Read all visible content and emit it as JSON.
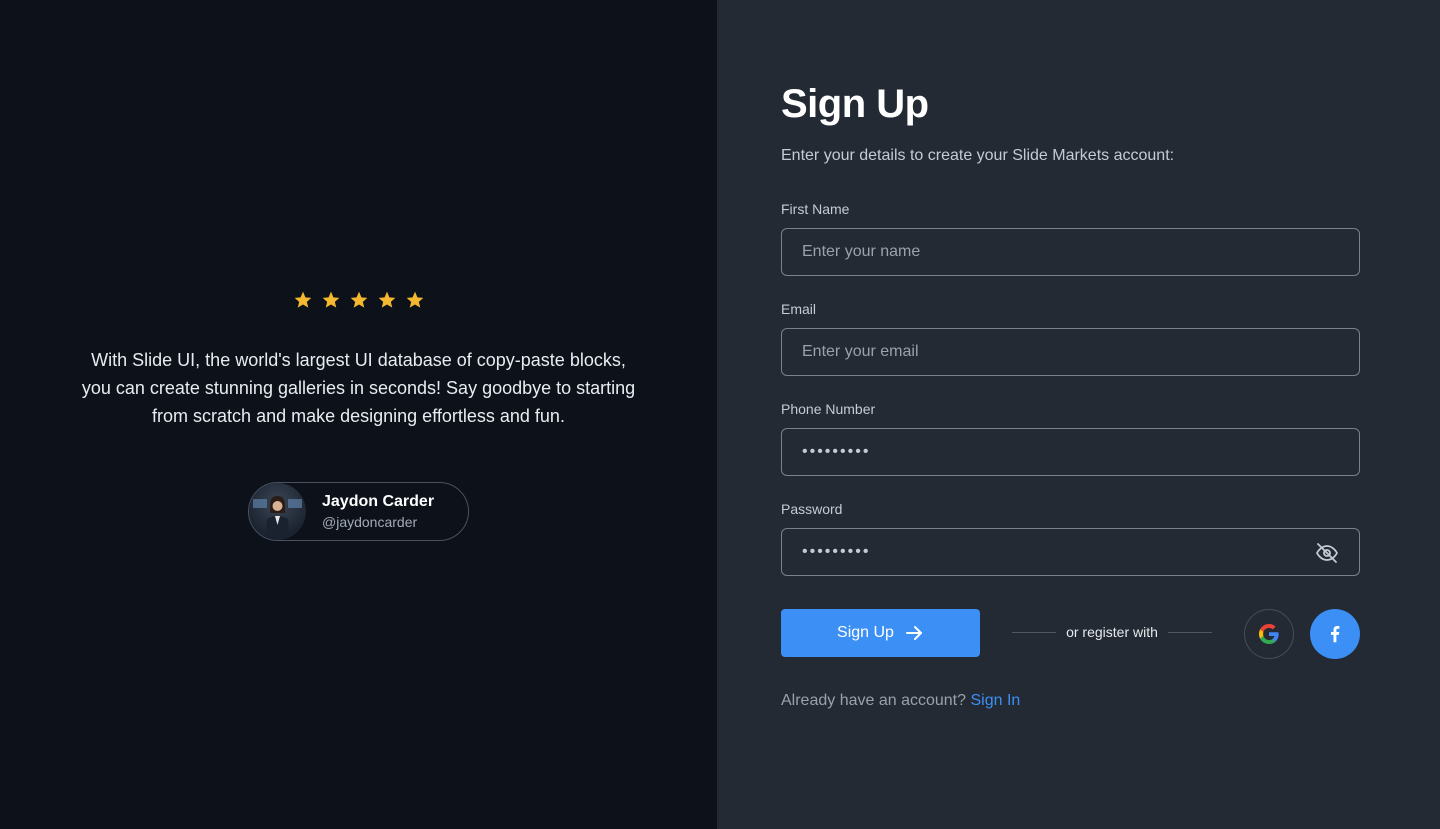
{
  "testimonial": {
    "rating": 5,
    "quote": "With Slide UI, the world's largest UI database of copy-paste blocks, you can create stunning galleries in seconds! Say goodbye to starting from scratch and make designing effortless and fun.",
    "author_name": "Jaydon Carder",
    "author_handle": "@jaydoncarder",
    "star_color": "#f5b82e"
  },
  "form": {
    "title": "Sign Up",
    "subtitle": "Enter your details to create your Slide Markets account:",
    "first_name": {
      "label": "First Name",
      "placeholder": "Enter your name",
      "value": ""
    },
    "email": {
      "label": "Email",
      "placeholder": "Enter your email",
      "value": ""
    },
    "phone": {
      "label": "Phone Number",
      "value": "•••••••••"
    },
    "password": {
      "label": "Password",
      "value": "•••••••••",
      "toggle_icon": "eye-off-icon"
    },
    "submit_label": "Sign Up",
    "divider_text": "or register with",
    "social": [
      "google",
      "facebook"
    ],
    "signin_prompt": "Already have an account?",
    "signin_link": "Sign In"
  },
  "colors": {
    "accent": "#3b8ff5",
    "left_bg": "#0c111a",
    "right_bg": "#232a33"
  }
}
